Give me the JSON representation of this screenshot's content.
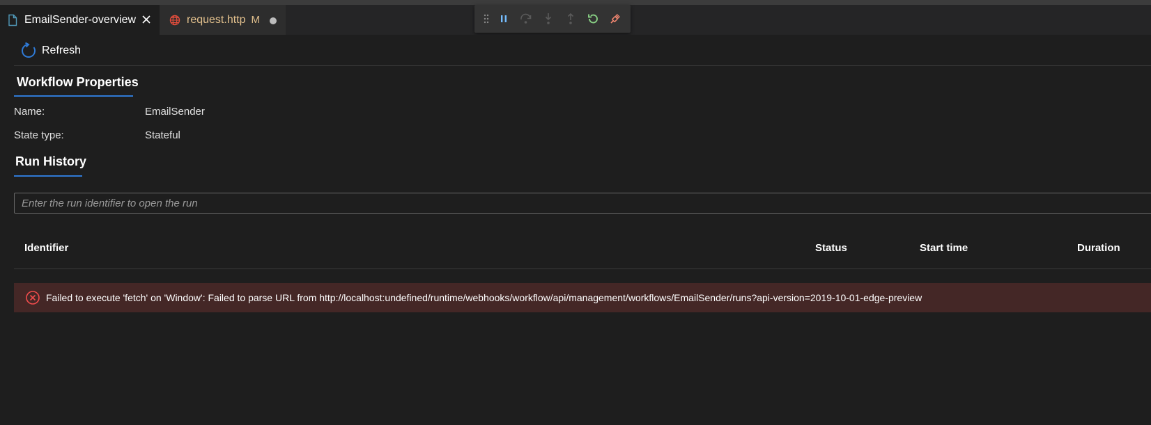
{
  "tabs": [
    {
      "label": "EmailSender-overview",
      "icon": "file-icon",
      "active": true
    },
    {
      "label": "request.http",
      "icon": "globe-icon",
      "status": "M",
      "active": false
    }
  ],
  "debug_toolbar": {
    "buttons": [
      "grip-icon",
      "pause-icon",
      "step-over-icon",
      "step-into-icon",
      "step-out-icon",
      "restart-icon",
      "disconnect-icon"
    ]
  },
  "toolbar": {
    "refresh_label": "Refresh"
  },
  "workflow_properties": {
    "heading": "Workflow Properties",
    "name_label": "Name:",
    "name_value": "EmailSender",
    "state_label": "State type:",
    "state_value": "Stateful"
  },
  "run_history": {
    "heading": "Run History",
    "search_placeholder": "Enter the run identifier to open the run",
    "columns": [
      "Identifier",
      "Status",
      "Start time",
      "Duration"
    ]
  },
  "error": {
    "message": "Failed to execute 'fetch' on 'Window': Failed to parse URL from http://localhost:undefined/runtime/webhooks/workflow/api/management/workflows/EmailSender/runs?api-version=2019-10-01-edge-preview"
  },
  "colors": {
    "accent": "#2f7ad6",
    "error_bg": "#442726",
    "modified": "#e2c08d",
    "restart": "#89d185",
    "disconnect": "#f48771"
  }
}
